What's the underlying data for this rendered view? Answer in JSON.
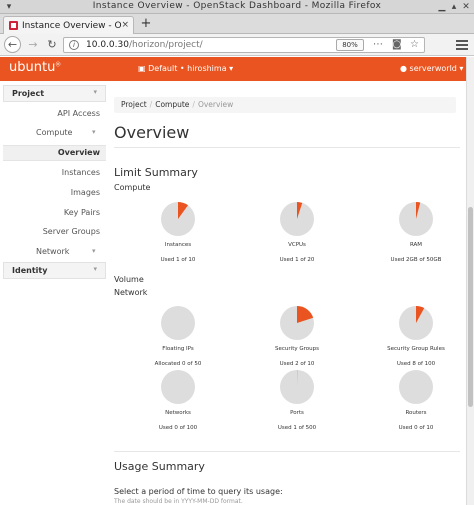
{
  "window": {
    "title": "Instance Overview - OpenStack Dashboard - Mozilla Firefox"
  },
  "tab": {
    "title": "Instance Overview - Open",
    "close": "×"
  },
  "newtab": "+",
  "nav": {
    "url_host": "10.0.0.30",
    "url_path": "/horizon/project/",
    "zoom": "80%"
  },
  "header": {
    "logo": "ubuntu",
    "project_selector": "Default • hiroshima ▾",
    "user": "serverworld ▾"
  },
  "sidebar": {
    "project_label": "Project",
    "api_access": "API Access",
    "compute_label": "Compute",
    "overview": "Overview",
    "instances": "Instances",
    "images": "Images",
    "key_pairs": "Key Pairs",
    "server_groups": "Server Groups",
    "network_label": "Network",
    "identity_label": "Identity"
  },
  "breadcrumb": {
    "project": "Project",
    "compute": "Compute",
    "current": "Overview"
  },
  "page_title": "Overview",
  "limit_summary": {
    "title": "Limit Summary",
    "compute_title": "Compute",
    "volume_title": "Volume",
    "network_title": "Network"
  },
  "chart_data": [
    {
      "type": "pie",
      "title": "Instances",
      "used": 1,
      "total": 10,
      "usage_text": "Used 1 of 10"
    },
    {
      "type": "pie",
      "title": "VCPUs",
      "used": 1,
      "total": 20,
      "usage_text": "Used 1 of 20"
    },
    {
      "type": "pie",
      "title": "RAM",
      "used": 2,
      "total": 50,
      "usage_text": "Used 2GB of 50GB"
    },
    {
      "type": "pie",
      "title": "Floating IPs",
      "used": 0,
      "total": 50,
      "usage_text": "Allocated 0 of 50"
    },
    {
      "type": "pie",
      "title": "Security Groups",
      "used": 2,
      "total": 10,
      "usage_text": "Used 2 of 10"
    },
    {
      "type": "pie",
      "title": "Security Group Rules",
      "used": 8,
      "total": 100,
      "usage_text": "Used 8 of 100"
    },
    {
      "type": "pie",
      "title": "Networks",
      "used": 0,
      "total": 100,
      "usage_text": "Used 0 of 100"
    },
    {
      "type": "pie",
      "title": "Ports",
      "used": 1,
      "total": 500,
      "usage_text": "Used 1 of 500"
    },
    {
      "type": "pie",
      "title": "Routers",
      "used": 0,
      "total": 10,
      "usage_text": "Used 0 of 10"
    }
  ],
  "usage_summary": {
    "title": "Usage Summary",
    "query_label": "Select a period of time to query its usage:",
    "hint": "The date should be in YYYY-MM-DD format."
  },
  "colors": {
    "accent": "#e95420",
    "pie_bg": "#dddddd"
  }
}
